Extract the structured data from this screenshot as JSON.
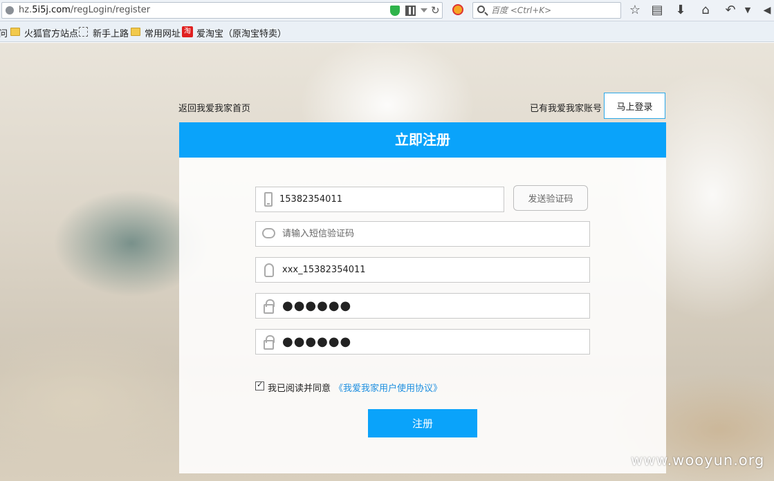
{
  "browser": {
    "url_prefix": "hz.",
    "url_domain": "5i5j.com",
    "url_path": "/regLogin/register",
    "search_placeholder": "百度 <Ctrl+K>",
    "bookmarks": [
      {
        "label": "问"
      },
      {
        "label": "火狐官方站点"
      },
      {
        "label": "新手上路"
      },
      {
        "label": "常用网址"
      },
      {
        "label": "爱淘宝（原淘宝特卖）"
      }
    ],
    "taobao_badge": "淘"
  },
  "top_links": {
    "back_home": "返回我爱我家首页",
    "have_account": "已有我爱我家账号",
    "login_button": "马上登录"
  },
  "register": {
    "title": "立即注册",
    "phone_value": "15382354011",
    "send_code_button": "发送验证码",
    "sms_code_placeholder": "请输入短信验证码",
    "username_value": "xxx_15382354011",
    "password_value": "●●●●●●",
    "confirm_password_value": "●●●●●●",
    "agree_text": "我已阅读并同意",
    "agreement_link": "《我爱我家用户使用协议》",
    "agree_checked": true,
    "submit_button": "注册",
    "accent_color": "#0aa3fa"
  },
  "watermark": "www.wooyun.org"
}
